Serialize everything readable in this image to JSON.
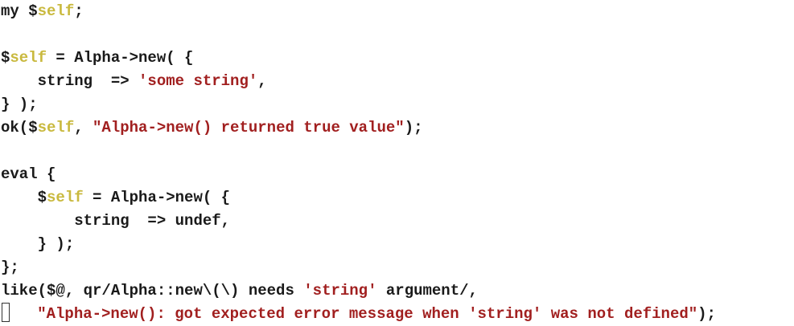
{
  "editor": {
    "colors": {
      "text": "#1a1a1a",
      "variable": "#c9b93e",
      "string": "#a11f1f",
      "background": "#ffffff"
    },
    "lines": [
      [
        {
          "t": "my $",
          "c": "plain"
        },
        {
          "t": "self",
          "c": "var"
        },
        {
          "t": ";",
          "c": "plain"
        }
      ],
      [],
      [
        {
          "t": "$",
          "c": "plain"
        },
        {
          "t": "self",
          "c": "var"
        },
        {
          "t": " = Alpha->new( {",
          "c": "plain"
        }
      ],
      [
        {
          "t": "    string  => ",
          "c": "plain"
        },
        {
          "t": "'some string'",
          "c": "str"
        },
        {
          "t": ",",
          "c": "plain"
        }
      ],
      [
        {
          "t": "} );",
          "c": "plain"
        }
      ],
      [
        {
          "t": "ok($",
          "c": "plain"
        },
        {
          "t": "self",
          "c": "var"
        },
        {
          "t": ", ",
          "c": "plain"
        },
        {
          "t": "\"Alpha->new() returned true value\"",
          "c": "str"
        },
        {
          "t": ");",
          "c": "plain"
        }
      ],
      [],
      [
        {
          "t": "eval {",
          "c": "plain"
        }
      ],
      [
        {
          "t": "    $",
          "c": "plain"
        },
        {
          "t": "self",
          "c": "var"
        },
        {
          "t": " = Alpha->new( {",
          "c": "plain"
        }
      ],
      [
        {
          "t": "        string  => undef,",
          "c": "plain"
        }
      ],
      [
        {
          "t": "    } );",
          "c": "plain"
        }
      ],
      [
        {
          "t": "};",
          "c": "plain"
        }
      ],
      [
        {
          "t": "like($@, qr/Alpha::new\\(\\) needs ",
          "c": "plain"
        },
        {
          "t": "'string'",
          "c": "str"
        },
        {
          "t": " argument/,",
          "c": "plain"
        }
      ],
      [
        {
          "t": "cursor",
          "c": "cursor"
        },
        {
          "t": "   ",
          "c": "plain"
        },
        {
          "t": "\"Alpha->new(): got expected error message when 'string' was not defined\"",
          "c": "str"
        },
        {
          "t": ");",
          "c": "plain"
        }
      ]
    ]
  }
}
